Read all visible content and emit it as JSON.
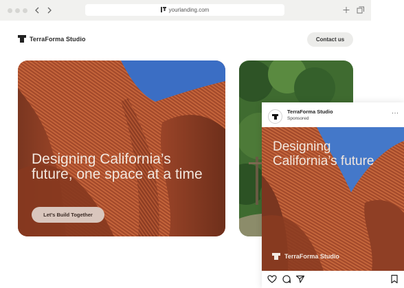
{
  "browser": {
    "url": "yourlanding.com",
    "back_icon": "chevron-left-icon",
    "forward_icon": "chevron-right-icon"
  },
  "site": {
    "brand": "TerraForma Studio",
    "contact_label": "Contact us"
  },
  "hero": {
    "heading": "Designing California’s future, one space at a time",
    "cta_label": "Let’s Build Together"
  },
  "post": {
    "account_name": "TerraForma Studio",
    "sponsored_label": "Sponsored",
    "more_label": "···",
    "heading": "Designing California’s future",
    "brand": "TerraForma Studio",
    "actions": [
      "heart-icon",
      "comment-icon",
      "share-icon",
      "bookmark-icon"
    ]
  },
  "colors": {
    "rust": "#a8492a",
    "sky": "#3d6fc0",
    "forest": "#2f5a2a",
    "button_bg": "#ececea"
  }
}
